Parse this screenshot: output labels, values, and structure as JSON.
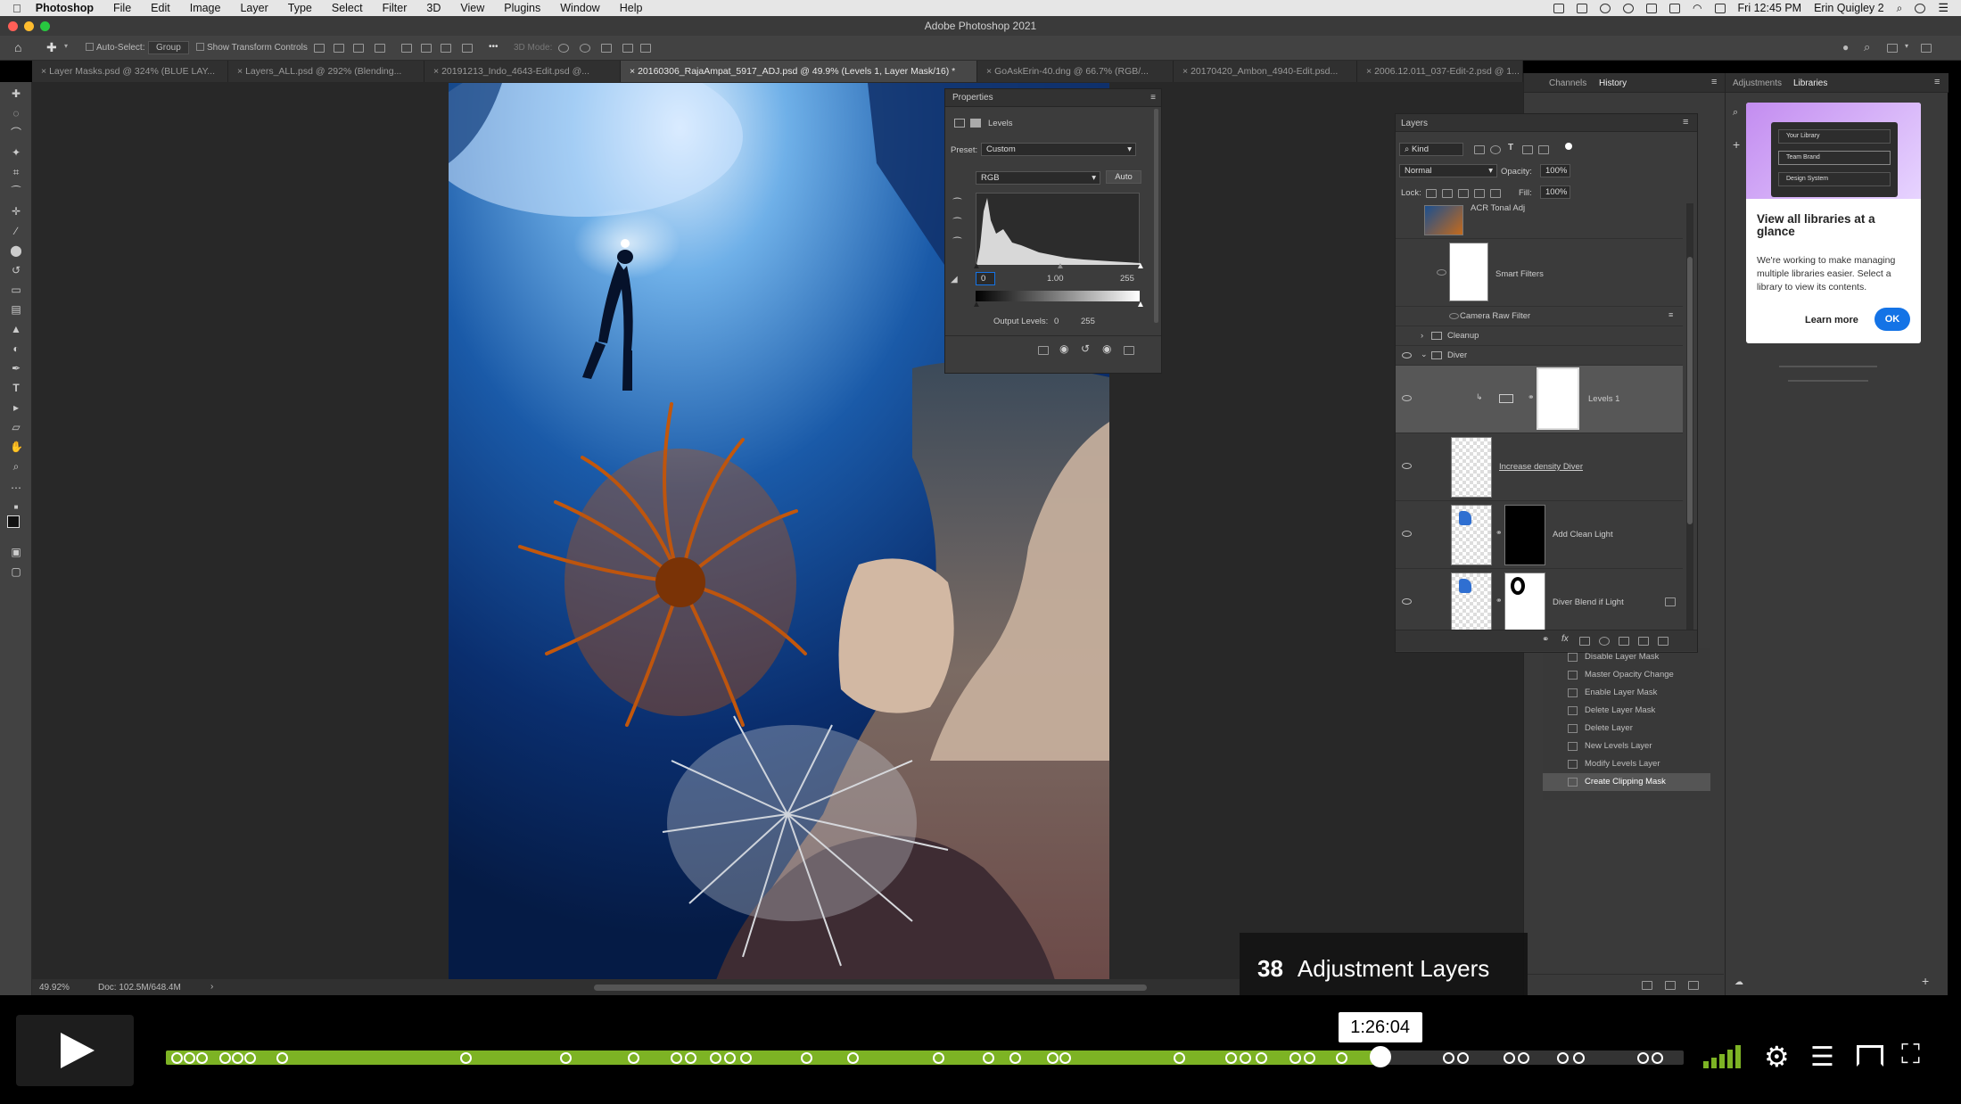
{
  "menubar": {
    "app": "Photoshop",
    "items": [
      "File",
      "Edit",
      "Image",
      "Layer",
      "Type",
      "Select",
      "Filter",
      "3D",
      "View",
      "Plugins",
      "Window",
      "Help"
    ],
    "clock": "Fri 12:45 PM",
    "user": "Erin Quigley 2"
  },
  "window": {
    "title": "Adobe Photoshop 2021"
  },
  "options": {
    "auto_select": "Auto-Select:",
    "group": "Group",
    "show_transform": "Show Transform Controls",
    "mode_3d": "3D Mode:",
    "more": "•••"
  },
  "tabs": [
    "Layer Masks.psd @ 324% (BLUE LAY...",
    "Layers_ALL.psd @ 292% (Blending...",
    "20191213_Indo_4643-Edit.psd @...",
    "20160306_RajaAmpat_5917_ADJ.psd @ 49.9% (Levels 1, Layer Mask/16) *",
    "GoAskErin-40.dng @ 66.7% (RGB/...",
    "20170420_Ambon_4940-Edit.psd...",
    "2006.12.011_037-Edit-2.psd @ 1..."
  ],
  "status": {
    "zoom": "49.92%",
    "doc": "Doc: 102.5M/648.4M",
    "arrow": "›"
  },
  "properties": {
    "title": "Properties",
    "kind": "Levels",
    "preset_label": "Preset:",
    "preset_value": "Custom",
    "channel": "RGB",
    "auto": "Auto",
    "input_black": "0",
    "input_gamma": "1.00",
    "input_white": "255",
    "output_label": "Output Levels:",
    "output_black": "0",
    "output_white": "255"
  },
  "layers": {
    "title": "Layers",
    "filter": "Kind",
    "blend": "Normal",
    "opacity_label": "Opacity:",
    "opacity": "100%",
    "lock_label": "Lock:",
    "fill_label": "Fill:",
    "fill": "100%",
    "rows": {
      "acr": "ACR Tonal Adj",
      "smart_filters": "Smart Filters",
      "camera_raw": "Camera Raw Filter",
      "cleanup": "Cleanup",
      "diver": "Diver",
      "levels": "Levels 1",
      "increase": "Increase density Diver",
      "clean_light": "Add Clean Light",
      "blend_light": "Diver Blend if Light"
    }
  },
  "dock": {
    "tab_channels": "Channels",
    "tab_history": "History",
    "tab_adjustments": "Adjustments",
    "tab_libraries": "Libraries"
  },
  "history": [
    "Disable Layer Mask",
    "Master Opacity Change",
    "Enable Layer Mask",
    "Delete Layer Mask",
    "Delete Layer",
    "New Levels Layer",
    "Modify Levels Layer",
    "Create Clipping Mask"
  ],
  "libraries": {
    "mock_your": "Your Library",
    "mock_team": "Team Brand",
    "mock_design": "Design System",
    "heading": "View all libraries at a glance",
    "body": "We're working to make managing multiple libraries easier. Select a library to view its contents.",
    "learn_more": "Learn more",
    "ok": "OK"
  },
  "player": {
    "chapter_number": "38",
    "chapter_title": "Adjustment Layers",
    "time": "1:26:04",
    "progress": 0.8
  },
  "colors": {
    "accent_green": "#7db324",
    "ps_blue": "#1473e6"
  }
}
